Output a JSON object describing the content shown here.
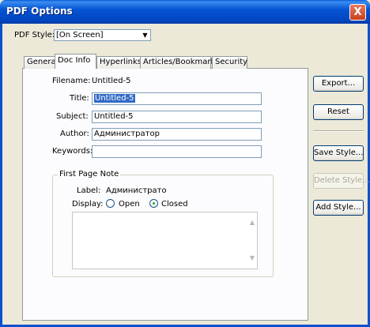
{
  "window": {
    "title": "PDF Options",
    "close_glyph": "X"
  },
  "style_select": {
    "label": "PDF Style:",
    "value": "[On Screen]",
    "arrow": "▼"
  },
  "tabs": [
    {
      "label": "General",
      "active": false
    },
    {
      "label": "Doc Info",
      "active": true
    },
    {
      "label": "Hyperlinks",
      "active": false
    },
    {
      "label": "Articles/Bookmarks",
      "active": false
    },
    {
      "label": "Security",
      "active": false
    }
  ],
  "doc_info": {
    "filename_label": "Filename:",
    "filename_value": "Untitled-5",
    "title_label": "Title:",
    "title_value": "Untitled-5",
    "subject_label": "Subject:",
    "subject_value": "Untitled-5",
    "author_label": "Author:",
    "author_value": "Администратор",
    "keywords_label": "Keywords:",
    "keywords_value": ""
  },
  "first_page_note": {
    "legend": "First Page Note",
    "label_label": "Label:",
    "label_value": "Администрато",
    "display_label": "Display:",
    "open_label": "Open",
    "closed_label": "Closed",
    "selected": "Closed",
    "note_text": "",
    "scroll_up": "▲",
    "scroll_down": "▼"
  },
  "buttons": {
    "export": "Export...",
    "reset": "Reset",
    "save_style": "Save Style...",
    "delete_style": "Delete Style...",
    "add_style": "Add Style..."
  }
}
